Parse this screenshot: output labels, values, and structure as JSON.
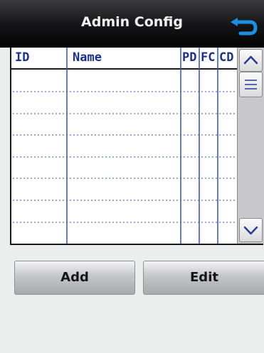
{
  "header": {
    "title": "Admin Config",
    "back_icon": "back-arrow-icon"
  },
  "table": {
    "columns": [
      "ID",
      "Name",
      "PD",
      "FC",
      "CD"
    ],
    "rows": [],
    "empty_row_count": 8
  },
  "scrollbar": {
    "up_icon": "chevron-up-icon",
    "thumb_icon": "grip-lines-icon",
    "down_icon": "chevron-down-icon"
  },
  "actions": {
    "add_label": "Add",
    "edit_label": "Edit"
  },
  "colors": {
    "header_text": "#1d2f8c",
    "grid_line": "#3550c0",
    "accent": "#1e8fe0"
  }
}
